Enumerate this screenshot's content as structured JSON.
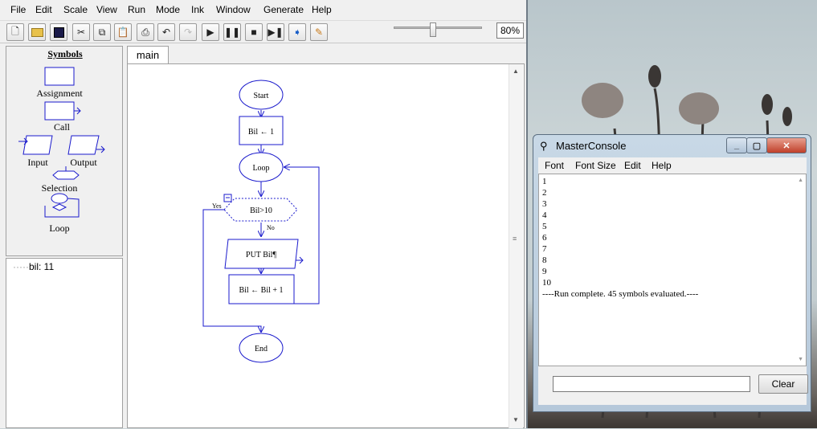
{
  "app": {
    "menu": [
      "File",
      "Edit",
      "Scale",
      "View",
      "Run",
      "Mode",
      "Ink",
      "Window",
      "Generate",
      "Help"
    ],
    "zoom": "80%",
    "toolbar_icons": [
      "new-icon",
      "open-icon",
      "save-icon",
      "cut-icon",
      "copy-icon",
      "paste-icon",
      "print-icon",
      "undo-icon",
      "redo-icon",
      "play-icon",
      "pause-icon",
      "stop-icon",
      "step-icon",
      "step-into-icon",
      "pen-icon"
    ]
  },
  "symbols": {
    "title": "Symbols",
    "items": [
      "Assignment",
      "Call",
      "Input",
      "Output",
      "Selection",
      "Loop"
    ]
  },
  "variables": {
    "items": [
      "bil: 11"
    ]
  },
  "tabs": [
    "main"
  ],
  "flowchart": {
    "start": "Start",
    "assign1": "Bil ← 1",
    "loop": "Loop",
    "condition": "Bil>10",
    "yes": "Yes",
    "no": "No",
    "output": "PUT Bil¶",
    "assign2": "Bil ← Bil + 1",
    "end": "End"
  },
  "console": {
    "title": "MasterConsole",
    "menu": [
      "Font",
      "Font Size",
      "Edit",
      "Help"
    ],
    "output_lines": [
      "1",
      "2",
      "3",
      "4",
      "5",
      "6",
      "7",
      "8",
      "9",
      "10",
      "----Run complete.  45 symbols evaluated.----"
    ],
    "clear_label": "Clear",
    "input_value": ""
  }
}
